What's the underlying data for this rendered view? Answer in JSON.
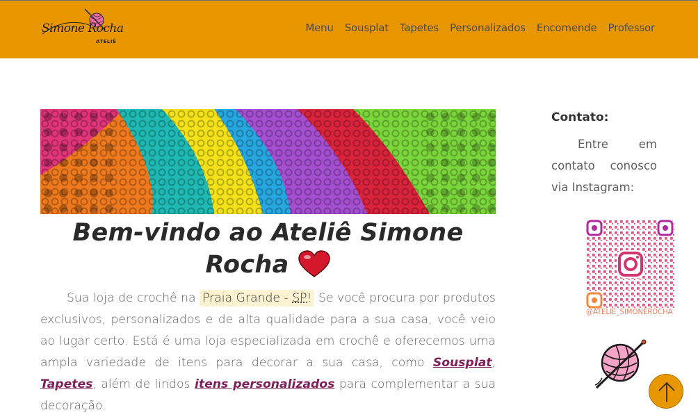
{
  "brand": {
    "name": "Simone Rocha",
    "subtitle": "ATELIÊ"
  },
  "nav": {
    "items": [
      "Menu",
      "Sousplat",
      "Tapetes",
      "Personalizados",
      "Encomende",
      "Professor"
    ]
  },
  "main": {
    "title": "Bem-vindo ao Ateliê Simone Rocha",
    "intro_start": "Sua loja de crochê na ",
    "location": "Praia Grande - ",
    "location_abbr": "SP",
    "location_end": "!",
    "intro_mid": " Se você procura por produtos exclusivos, personalizados e de alta qualidade para a sua casa, você veio ao lugar certo. Está é uma loja especializada em crochê e oferecemos uma ampla variedade de itens para decorar a sua casa, como ",
    "link_sousplat": "Sousplat",
    "comma": ", ",
    "link_tapetes": "Tapetes",
    "intro_after_tapetes": ", além de lindos ",
    "link_personalizados": "itens personalizados",
    "intro_end": " para complementar a sua decoração."
  },
  "sidebar": {
    "contact_title": "Contato:",
    "contact_text": "Entre em contato conosco via Instagram:",
    "instagram_handle": "@ATELIE_SIMONEROCHA"
  },
  "icons": {
    "heart": "heart-icon",
    "back_to_top": "arrow-up-icon",
    "instagram_qr": "qr-code",
    "yarn": "yarn-ball-icon"
  },
  "colors": {
    "header_bg": "#e99700",
    "accent_link": "#7d1f5a",
    "highlight_bg": "#fdf3d2",
    "instagram_gradient_start": "#c13584",
    "instagram_gradient_end": "#f77737"
  }
}
